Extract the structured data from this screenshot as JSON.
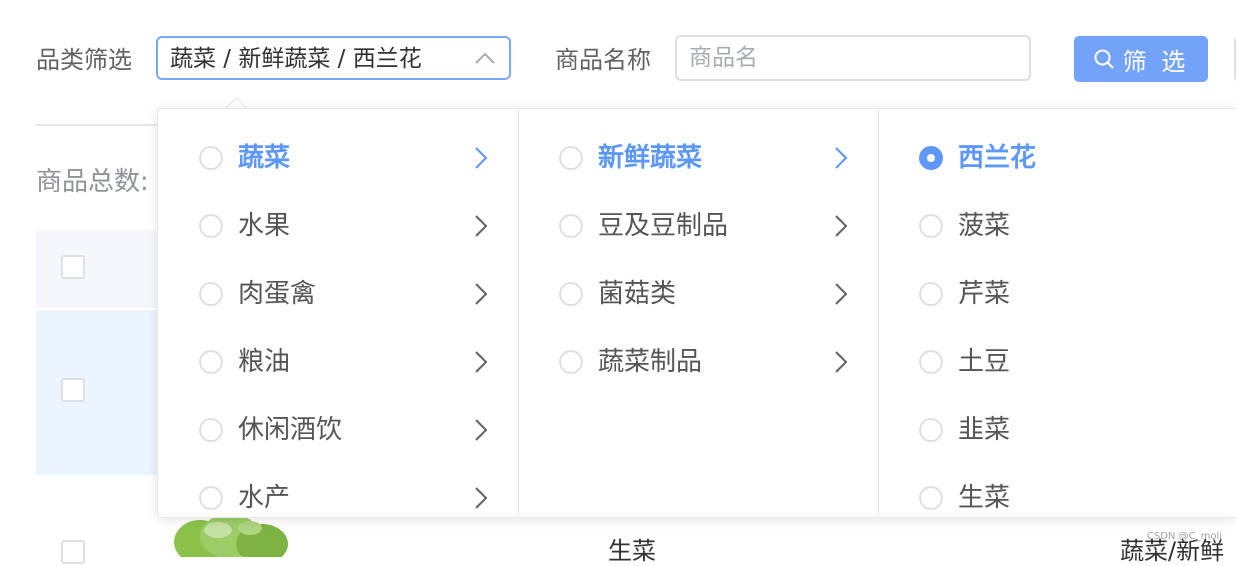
{
  "filter": {
    "category_label": "品类筛选",
    "category_value": "蔬菜 / 新鲜蔬菜 / 西兰花",
    "name_label": "商品名称",
    "name_placeholder": "商品名",
    "name_value": "",
    "filter_button": "筛 选"
  },
  "summary": {
    "total_label": "商品总数:"
  },
  "table": {
    "row2_text": "生菜",
    "row2_right_text": "蔬菜/新鲜"
  },
  "cascader": {
    "level1": [
      {
        "label": "蔬菜",
        "active": true
      },
      {
        "label": "水果"
      },
      {
        "label": "肉蛋禽"
      },
      {
        "label": "粮油"
      },
      {
        "label": "休闲酒饮"
      },
      {
        "label": "水产"
      }
    ],
    "level2": [
      {
        "label": "新鲜蔬菜",
        "active": true
      },
      {
        "label": "豆及豆制品"
      },
      {
        "label": "菌菇类"
      },
      {
        "label": "蔬菜制品"
      }
    ],
    "level3": [
      {
        "label": "西兰花",
        "selected": true
      },
      {
        "label": "菠菜"
      },
      {
        "label": "芹菜"
      },
      {
        "label": "土豆"
      },
      {
        "label": "韭菜"
      },
      {
        "label": "生菜"
      }
    ]
  },
  "watermark": "CSDN @C_moli",
  "colors": {
    "primary": "#5d98f8",
    "button": "#73a3f8",
    "border": "#dcdfe6",
    "row_highlight": "#ecf5ff"
  }
}
